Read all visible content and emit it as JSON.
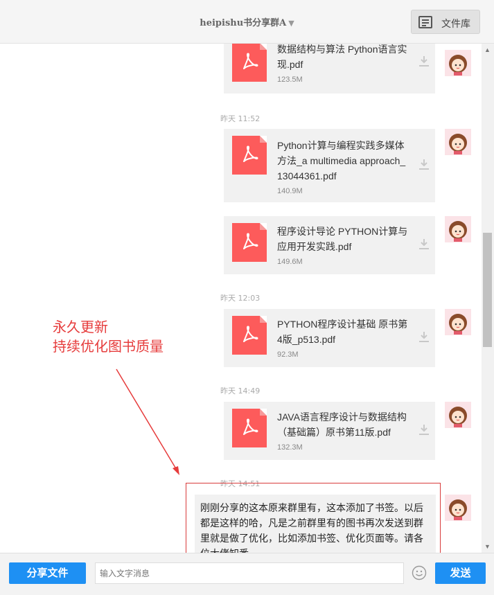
{
  "header": {
    "group_name": "heipishu书分享群A",
    "dropdown_arrow": "▼",
    "library_label": "文件库"
  },
  "messages": [
    {
      "time": "",
      "file_name": "数据结构与算法 Python语言实现.pdf",
      "file_lines": [
        "数据结构与算法 Python语言实",
        "现.pdf"
      ],
      "size": "123.5M"
    },
    {
      "time": "昨天 11:52",
      "file_name": "Python计算与编程实践多媒体方法_a multimedia approach_13044361.pdf",
      "file_lines": [
        "Python计算与编程实践多媒体",
        "方法_a multimedia approach_",
        "13044361.pdf"
      ],
      "size": "140.9M"
    },
    {
      "time": "",
      "file_name": "程序设计导论 PYTHON计算与应用开发实践.pdf",
      "file_lines": [
        "程序设计导论 PYTHON计算与",
        "应用开发实践.pdf"
      ],
      "size": "149.6M"
    },
    {
      "time": "昨天 12:03",
      "file_name": "PYTHON程序设计基础 原书第4版_p513.pdf",
      "file_lines": [
        "PYTHON程序设计基础 原书第",
        "4版_p513.pdf"
      ],
      "size": "92.3M"
    },
    {
      "time": "昨天 14:49",
      "file_name": "JAVA语言程序设计与数据结构（基础篇）原书第11版.pdf",
      "file_lines": [
        "JAVA语言程序设计与数据结构",
        "（基础篇）原书第11版.pdf"
      ],
      "size": "132.3M"
    }
  ],
  "last_message": {
    "time": "昨天 14:51",
    "text": "刚刚分享的这本原来群里有，这本添加了书签。以后都是这样的哈，凡是之前群里有的图书再次发送到群里就是做了优化，比如添加书签、优化页面等。请各位大佬知悉。"
  },
  "annotation": {
    "line1": "永久更新",
    "line2": "持续优化图书质量",
    "color": "#e63b3b"
  },
  "footer": {
    "share_label": "分享文件",
    "input_placeholder": "输入文字消息",
    "send_label": "发送"
  },
  "colors": {
    "accent": "#1e90f3",
    "pdf_icon": "#fd5b5b"
  },
  "icons": [
    "library-icon",
    "pdf-icon",
    "download-icon",
    "emoji-icon"
  ]
}
